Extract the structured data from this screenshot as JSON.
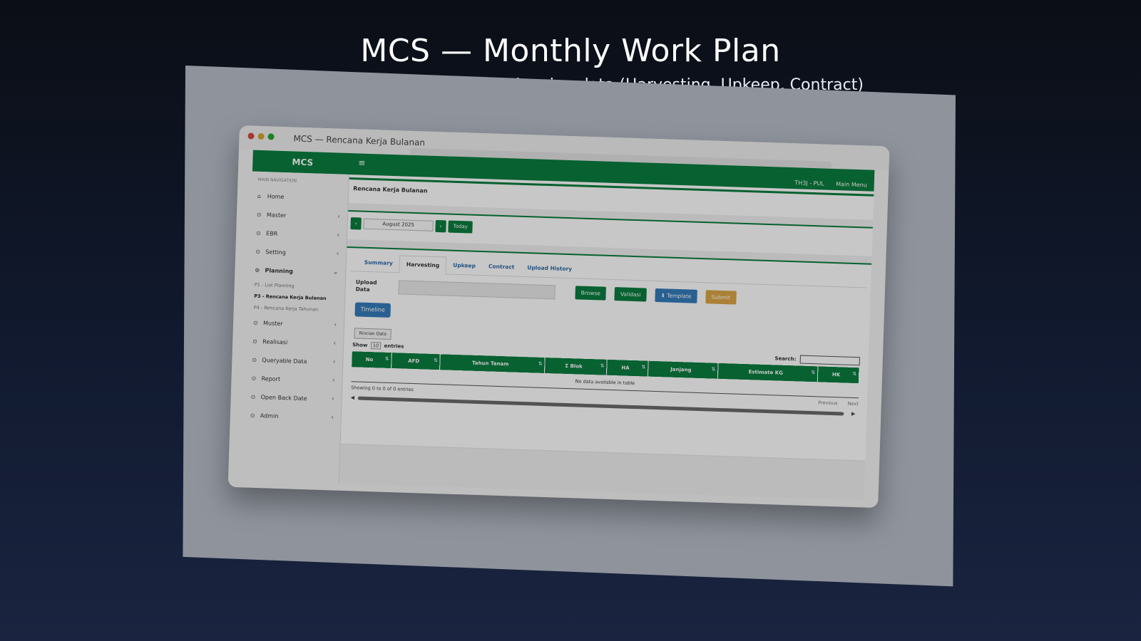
{
  "hero": {
    "title": "MCS — Monthly Work Plan",
    "subtitle": "Import, validate, and submit planning data (Harvesting, Upkeep, Contract)"
  },
  "window": {
    "title": "MCS — Rencana Kerja Bulanan"
  },
  "topbar": {
    "logo": "MCS",
    "menu_icon": "≡",
    "user": "TH3J - PUL",
    "main_menu": "Main Menu"
  },
  "sidebar": {
    "header": "MAIN NAVIGATION",
    "items": [
      {
        "label": "Home",
        "icon": "home-icon"
      },
      {
        "label": "Master",
        "icon": "circle-icon"
      },
      {
        "label": "EBR",
        "icon": "circle-icon"
      },
      {
        "label": "Setting",
        "icon": "circle-icon"
      },
      {
        "label": "Planning",
        "icon": "circle-icon"
      },
      {
        "label": "Muster",
        "icon": "circle-icon"
      },
      {
        "label": "Realisasi",
        "icon": "circle-icon"
      },
      {
        "label": "Queryable Data",
        "icon": "circle-icon"
      },
      {
        "label": "Report",
        "icon": "circle-icon"
      },
      {
        "label": "Open Back Date",
        "icon": "circle-icon"
      },
      {
        "label": "Admin",
        "icon": "circle-icon"
      }
    ],
    "planning_sub": [
      {
        "label": "P1 - List Planning"
      },
      {
        "label": "P3 - Rencana Kerja Bulanan"
      },
      {
        "label": "P4 - Rencana Kerja Tahunan"
      }
    ]
  },
  "page": {
    "title": "Rencana Kerja Bulanan",
    "month": "August 2025",
    "today_label": "Today",
    "prev": "‹",
    "next": "›"
  },
  "tabs": [
    "Summary",
    "Harvesting",
    "Upkeep",
    "Contract",
    "Upload History"
  ],
  "upload": {
    "label": "Upload Data",
    "browse": "Browse",
    "validasi": "Validasi",
    "template": "Template",
    "submit": "Submit"
  },
  "timeline_label": "Timeline",
  "rincian_label": "Rincian Data",
  "table": {
    "show_label": "Show",
    "page_size": "10",
    "entries_label": "entries",
    "search_label": "Search:",
    "columns": [
      "No",
      "AFD",
      "Tahun Tanam",
      "Σ Blok",
      "HA",
      "Janjang",
      "Estimate KG",
      "HK"
    ],
    "empty": "No data available in table",
    "info": "Showing 0 to 0 of 0 entries",
    "previous": "Previous",
    "next": "Next"
  },
  "colors": {
    "primary_green": "#00803a",
    "info_blue": "#2e7cc4",
    "warning_orange": "#e0a53c"
  }
}
